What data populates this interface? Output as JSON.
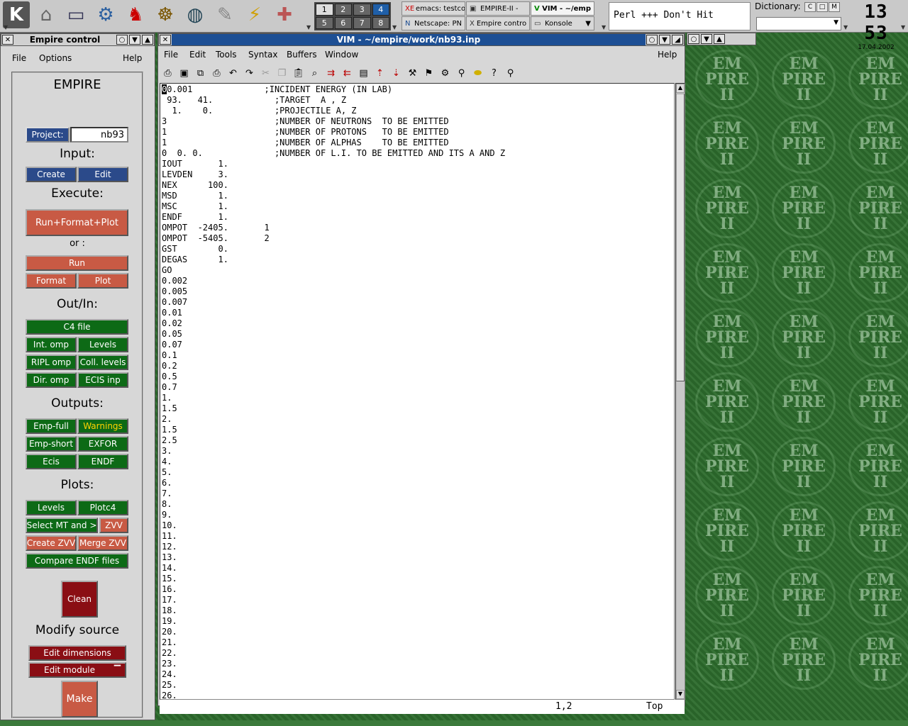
{
  "taskbar": {
    "pager": [
      "1",
      "2",
      "3",
      "4",
      "5",
      "6",
      "7",
      "8"
    ],
    "tasks": [
      {
        "icon": "XE",
        "label": "emacs: testco"
      },
      {
        "icon": "▣",
        "label": "EMPIRE-II -"
      },
      {
        "icon": "V",
        "label": "VIM - ~/emp",
        "active": true
      },
      {
        "icon": "N",
        "label": "Netscape: PN"
      },
      {
        "icon": "X",
        "label": "Empire contro"
      },
      {
        "icon": "▭",
        "label": "Konsole"
      }
    ],
    "marquee": "Perl +++  Don't Hit",
    "dictionary_label": "Dictionary:",
    "dictionary_buttons": [
      "C",
      "□",
      "M"
    ],
    "clock_time": "13 53",
    "clock_date": "17.04.2002"
  },
  "empire": {
    "title": "Empire control",
    "menu": {
      "file": "File",
      "options": "Options",
      "help": "Help"
    },
    "heading": "EMPIRE",
    "project_label": "Project:",
    "project_value": "nb93",
    "input_heading": "Input:",
    "create": "Create",
    "edit": "Edit",
    "execute_heading": "Execute:",
    "run_format_plot": "Run+Format+Plot",
    "or": "or :",
    "run": "Run",
    "format": "Format",
    "plot": "Plot",
    "outin_heading": "Out/In:",
    "c4file": "C4 file",
    "int_omp": "Int. omp",
    "levels": "Levels",
    "ripl_omp": "RIPL omp",
    "coll_levels": "Coll. levels",
    "dir_omp": "Dir. omp",
    "ecis_inp": "ECIS inp",
    "outputs_heading": "Outputs:",
    "emp_full": "Emp-full",
    "warnings": "Warnings",
    "emp_short": "Emp-short",
    "exfor": "EXFOR",
    "ecis": "Ecis",
    "endf": "ENDF",
    "plots_heading": "Plots:",
    "plot_levels": "Levels",
    "plotc4": "Plotc4",
    "select_mt": "Select MT and >",
    "zvv": "ZVV",
    "create_zvv": "Create ZVV",
    "merge_zvv": "Merge ZVV",
    "compare_endf": "Compare ENDF files",
    "clean": "Clean",
    "modify_heading": "Modify source",
    "edit_dimensions": "Edit dimensions",
    "edit_module": "Edit  module",
    "make": "Make"
  },
  "vim": {
    "title": "VIM - ~/empire/work/nb93.inp",
    "menu": {
      "file": "File",
      "edit": "Edit",
      "tools": "Tools",
      "syntax": "Syntax",
      "buffers": "Buffers",
      "window": "Window",
      "help": "Help"
    },
    "first_char": "0",
    "first_rest": "0.001              ;INCIDENT ENERGY (IN LAB)",
    "body": " 93.   41.            ;TARGET  A , Z\n  1.    0.            ;PROJECTILE A, Z\n3                     ;NUMBER OF NEUTRONS  TO BE EMITTED\n1                     ;NUMBER OF PROTONS   TO BE EMITTED\n1                     ;NUMBER OF ALPHAS    TO BE EMITTED\n0  0. 0.              ;NUMBER OF L.I. TO BE EMITTED AND ITS A AND Z\nIOUT       1.\nLEVDEN     3.\nNEX      100.\nMSD        1.\nMSC        1.\nENDF       1.\nOMPOT  -2405.       1\nOMPOT  -5405.       2\nGST        0.\nDEGAS      1.\nGO\n0.002\n0.005\n0.007\n0.01\n0.02\n0.05\n0.07\n0.1\n0.2\n0.5\n0.7\n1.\n1.5\n2.\n1.5\n2.5\n3.\n4.\n5.\n6.\n7.\n8.\n9.\n10.\n11.\n12.\n13.\n14.\n15.\n16.\n17.\n18.\n19.\n20.\n21.\n22.\n23.\n24.\n25.\n26.",
    "status_pos": "1,2",
    "status_scroll": "Top"
  },
  "wallpaper": {
    "line1": "EM",
    "line2": "PIRE",
    "line3": "II"
  }
}
